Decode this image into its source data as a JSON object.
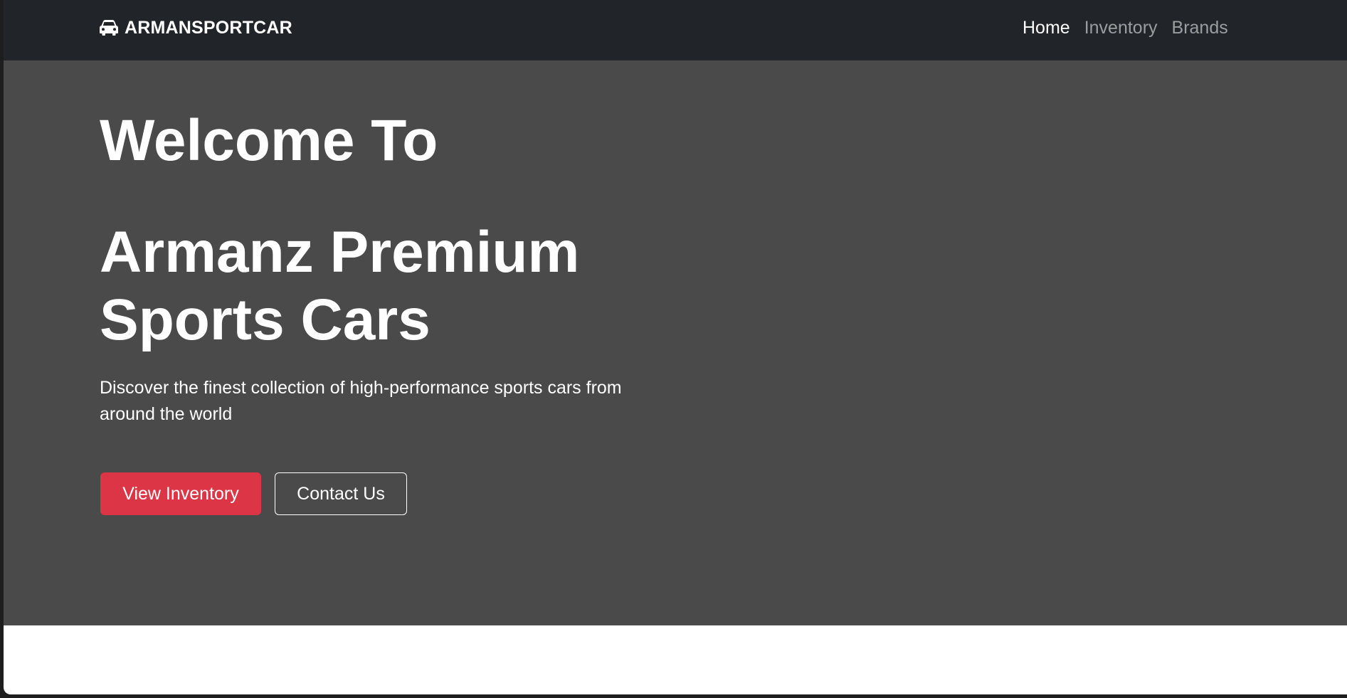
{
  "navbar": {
    "brand": "ARMANSPORTCAR",
    "brand_icon": "car-icon",
    "links": [
      {
        "label": "Home",
        "active": true
      },
      {
        "label": "Inventory",
        "active": false
      },
      {
        "label": "Brands",
        "active": false
      }
    ]
  },
  "hero": {
    "heading_line1": "Welcome To",
    "heading_line2": "Armanz Premium",
    "heading_line3": "Sports Cars",
    "lead": "Discover the finest collection of high-performance sports cars from around the world",
    "primary_button": "View Inventory",
    "secondary_button": "Contact Us"
  },
  "colors": {
    "navbar_bg": "#212529",
    "hero_bg": "#4a4a4a",
    "accent_red": "#dc3545",
    "text": "#ffffff"
  }
}
